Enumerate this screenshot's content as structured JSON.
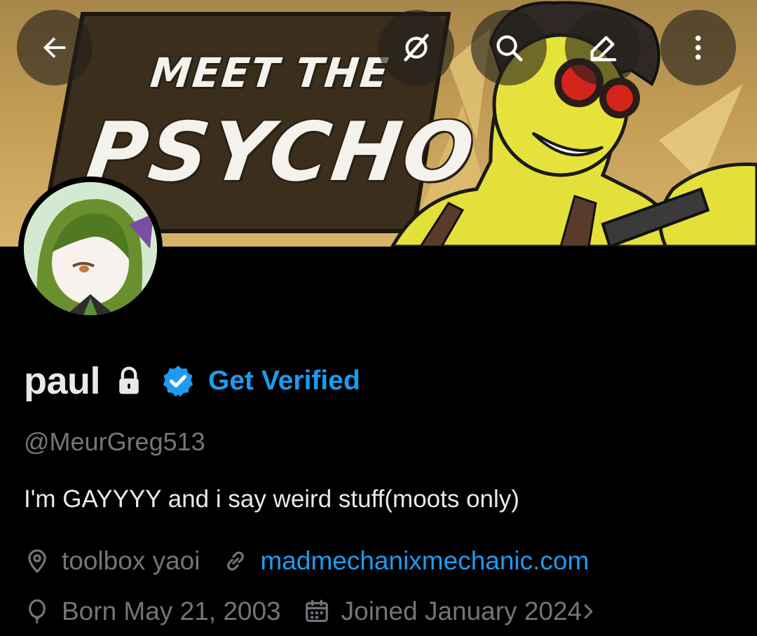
{
  "banner": {
    "line1": "MEET THE",
    "line2": "PSYCHO"
  },
  "topbar": {
    "icons": [
      "back-arrow-icon",
      "grok-icon",
      "search-icon",
      "edit-icon",
      "more-vertical-icon"
    ]
  },
  "profile": {
    "display_name": "paul",
    "get_verified_label": "Get Verified",
    "handle": "@MeurGreg513",
    "bio": "I'm GAYYYY and i say weird stuff(moots only)",
    "location": "toolbox yaoi",
    "website": "madmechanixmechanic.com",
    "birthday": "Born May 21, 2003",
    "joined": "Joined January 2024"
  },
  "colors": {
    "accent": "#1d9bf0",
    "muted": "#71767b",
    "text": "#e7e9ea",
    "background": "#000000"
  }
}
